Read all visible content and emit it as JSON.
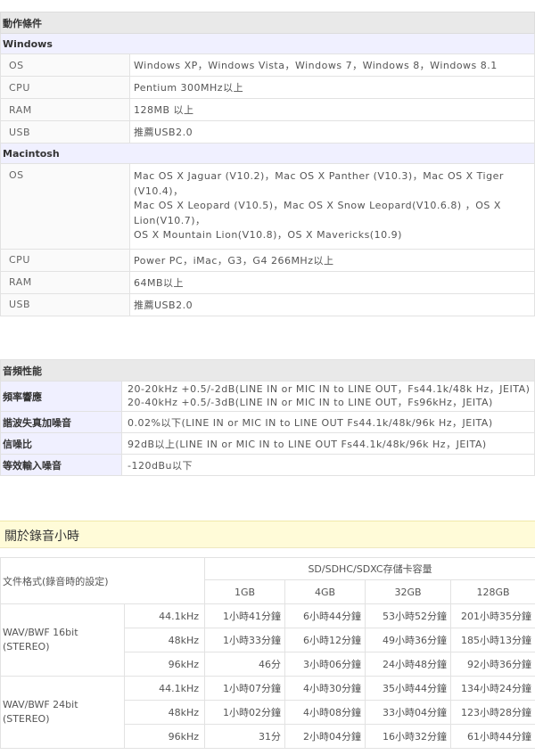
{
  "system": {
    "section_title": "動作條件",
    "windows": {
      "title": "Windows",
      "rows": [
        {
          "label": "OS",
          "value": "Windows XP，Windows Vista，Windows 7，Windows 8，Windows 8.1"
        },
        {
          "label": "CPU",
          "value": "Pentium 300MHz以上"
        },
        {
          "label": "RAM",
          "value": "128MB 以上"
        },
        {
          "label": "USB",
          "value": "推薦USB2.0"
        }
      ]
    },
    "mac": {
      "title": "Macintosh",
      "os_label": "OS",
      "os_lines": [
        "Mac OS X Jaguar (V10.2)，Mac OS X Panther (V10.3)，Mac OS X Tiger",
        "(V10.4)，",
        "Mac OS X Leopard (V10.5)，Mac OS X Snow Leopard(V10.6.8) ，OS X",
        "Lion(V10.7)，",
        "OS X Mountain Lion(V10.8)，OS X Mavericks(10.9)"
      ],
      "rows": [
        {
          "label": "CPU",
          "value": "Power PC，iMac，G3，G4 266MHz以上"
        },
        {
          "label": "RAM",
          "value": "64MB以上"
        },
        {
          "label": "USB",
          "value": "推薦USB2.0"
        }
      ]
    }
  },
  "audio": {
    "section_title": "音頻性能",
    "freq": {
      "label": "頻率響應",
      "lines": [
        "20-20kHz +0.5/-2dB(LINE IN or MIC IN to LINE OUT，Fs44.1k/48k Hz，JEITA)",
        "20-40kHz +0.5/-3dB(LINE IN or MIC IN to LINE OUT，Fs96kHz，JEITA)"
      ]
    },
    "rows": [
      {
        "label": "諧波失真加噪音",
        "value": "0.02%以下(LINE IN or MIC IN to LINE OUT Fs44.1k/48k/96k Hz，JEITA)"
      },
      {
        "label": "信噪比",
        "value": "92dB以上(LINE IN or MIC IN to LINE OUT Fs44.1k/48k/96k Hz，JEITA)"
      },
      {
        "label": "等效輸入噪音",
        "value": "-120dBu以下"
      }
    ]
  },
  "recording": {
    "title": "關於錄音小時",
    "format_header": "文件格式(錄音時的設定)",
    "capacity_header": "SD/SDHC/SDXC存儲卡容量",
    "capacities": [
      "1GB",
      "4GB",
      "32GB",
      "128GB"
    ],
    "groups": [
      {
        "format_lines": [
          "WAV/BWF 16bit",
          "(STEREO)"
        ],
        "rows": [
          {
            "fs": "44.1kHz",
            "times": [
              "1小時41分鐘",
              "6小時44分鐘",
              "53小時52分鐘",
              "201小時35分鐘"
            ]
          },
          {
            "fs": "48kHz",
            "times": [
              "1小時33分鐘",
              "6小時12分鐘",
              "49小時36分鐘",
              "185小時13分鐘"
            ]
          },
          {
            "fs": "96kHz",
            "times": [
              "46分",
              "3小時06分鐘",
              "24小時48分鐘",
              "92小時36分鐘"
            ]
          }
        ]
      },
      {
        "format_lines": [
          "WAV/BWF 24bit",
          "(STEREO)"
        ],
        "rows": [
          {
            "fs": "44.1kHz",
            "times": [
              "1小時07分鐘",
              "4小時30分鐘",
              "35小時44分鐘",
              "134小時24分鐘"
            ]
          },
          {
            "fs": "48kHz",
            "times": [
              "1小時02分鐘",
              "4小時08分鐘",
              "33小時04分鐘",
              "123小時28分鐘"
            ]
          },
          {
            "fs": "96kHz",
            "times": [
              "31分",
              "2小時04分鐘",
              "16小時32分鐘",
              "61小時44分鐘"
            ]
          }
        ]
      }
    ]
  }
}
